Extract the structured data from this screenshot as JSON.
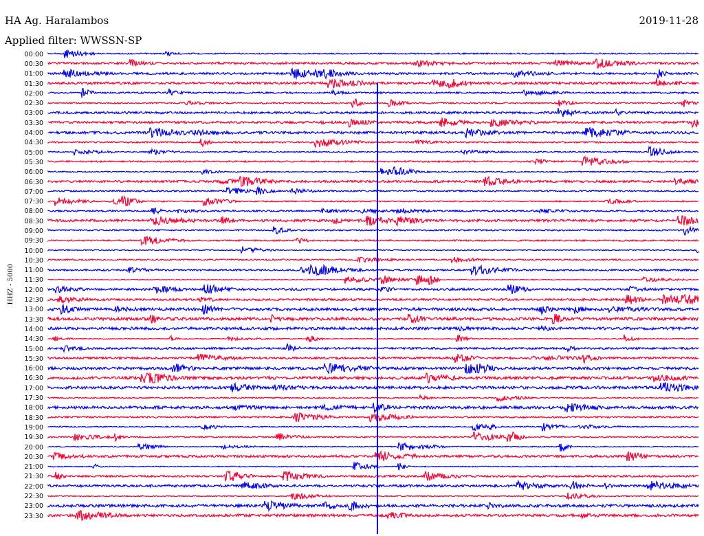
{
  "header": {
    "station": "HA Ag. Haralambos",
    "date": "2019-11-28",
    "filter": "Applied filter: WWSSN-SP"
  },
  "axis_label": "HHZ - 5000",
  "traces": [
    {
      "time": "00:00",
      "color": "#0000ff"
    },
    {
      "time": "00:30",
      "color": "#ff0033"
    },
    {
      "time": "01:00",
      "color": "#0000ff"
    },
    {
      "time": "01:30",
      "color": "#ff0033"
    },
    {
      "time": "02:00",
      "color": "#0000ff"
    },
    {
      "time": "02:30",
      "color": "#ff0033"
    },
    {
      "time": "03:00",
      "color": "#0000ff"
    },
    {
      "time": "03:30",
      "color": "#ff0033"
    },
    {
      "time": "04:00",
      "color": "#0000ff"
    },
    {
      "time": "04:30",
      "color": "#ff0033"
    },
    {
      "time": "05:00",
      "color": "#0000ff"
    },
    {
      "time": "05:30",
      "color": "#ff0033"
    },
    {
      "time": "06:00",
      "color": "#0000ff"
    },
    {
      "time": "06:30",
      "color": "#ff0033"
    },
    {
      "time": "07:00",
      "color": "#0000ff"
    },
    {
      "time": "07:30",
      "color": "#ff0033"
    },
    {
      "time": "08:00",
      "color": "#0000ff"
    },
    {
      "time": "08:30",
      "color": "#ff0033"
    },
    {
      "time": "09:00",
      "color": "#0000ff"
    },
    {
      "time": "09:30",
      "color": "#ff0033"
    },
    {
      "time": "10:00",
      "color": "#0000ff"
    },
    {
      "time": "10:30",
      "color": "#ff0033"
    },
    {
      "time": "11:00",
      "color": "#0000ff"
    },
    {
      "time": "11:30",
      "color": "#ff0033"
    },
    {
      "time": "12:00",
      "color": "#0000ff"
    },
    {
      "time": "12:30",
      "color": "#ff0033"
    },
    {
      "time": "13:00",
      "color": "#0000ff"
    },
    {
      "time": "13:30",
      "color": "#ff0033"
    },
    {
      "time": "14:00",
      "color": "#0000ff"
    },
    {
      "time": "14:30",
      "color": "#ff0033"
    },
    {
      "time": "15:00",
      "color": "#0000ff"
    },
    {
      "time": "15:30",
      "color": "#ff0033"
    },
    {
      "time": "16:00",
      "color": "#0000ff"
    },
    {
      "time": "16:30",
      "color": "#ff0033"
    },
    {
      "time": "17:00",
      "color": "#0000ff"
    },
    {
      "time": "17:30",
      "color": "#ff0033"
    },
    {
      "time": "18:00",
      "color": "#0000ff"
    },
    {
      "time": "18:30",
      "color": "#ff0033"
    },
    {
      "time": "19:00",
      "color": "#0000ff"
    },
    {
      "time": "19:30",
      "color": "#ff0033"
    },
    {
      "time": "20:00",
      "color": "#0000ff"
    },
    {
      "time": "20:30",
      "color": "#ff0033"
    },
    {
      "time": "21:00",
      "color": "#0000ff"
    },
    {
      "time": "21:30",
      "color": "#ff0033"
    },
    {
      "time": "22:00",
      "color": "#0000ff"
    },
    {
      "time": "22:30",
      "color": "#ff0033"
    },
    {
      "time": "23:00",
      "color": "#0000ff"
    },
    {
      "time": "23:30",
      "color": "#ff0033"
    }
  ]
}
